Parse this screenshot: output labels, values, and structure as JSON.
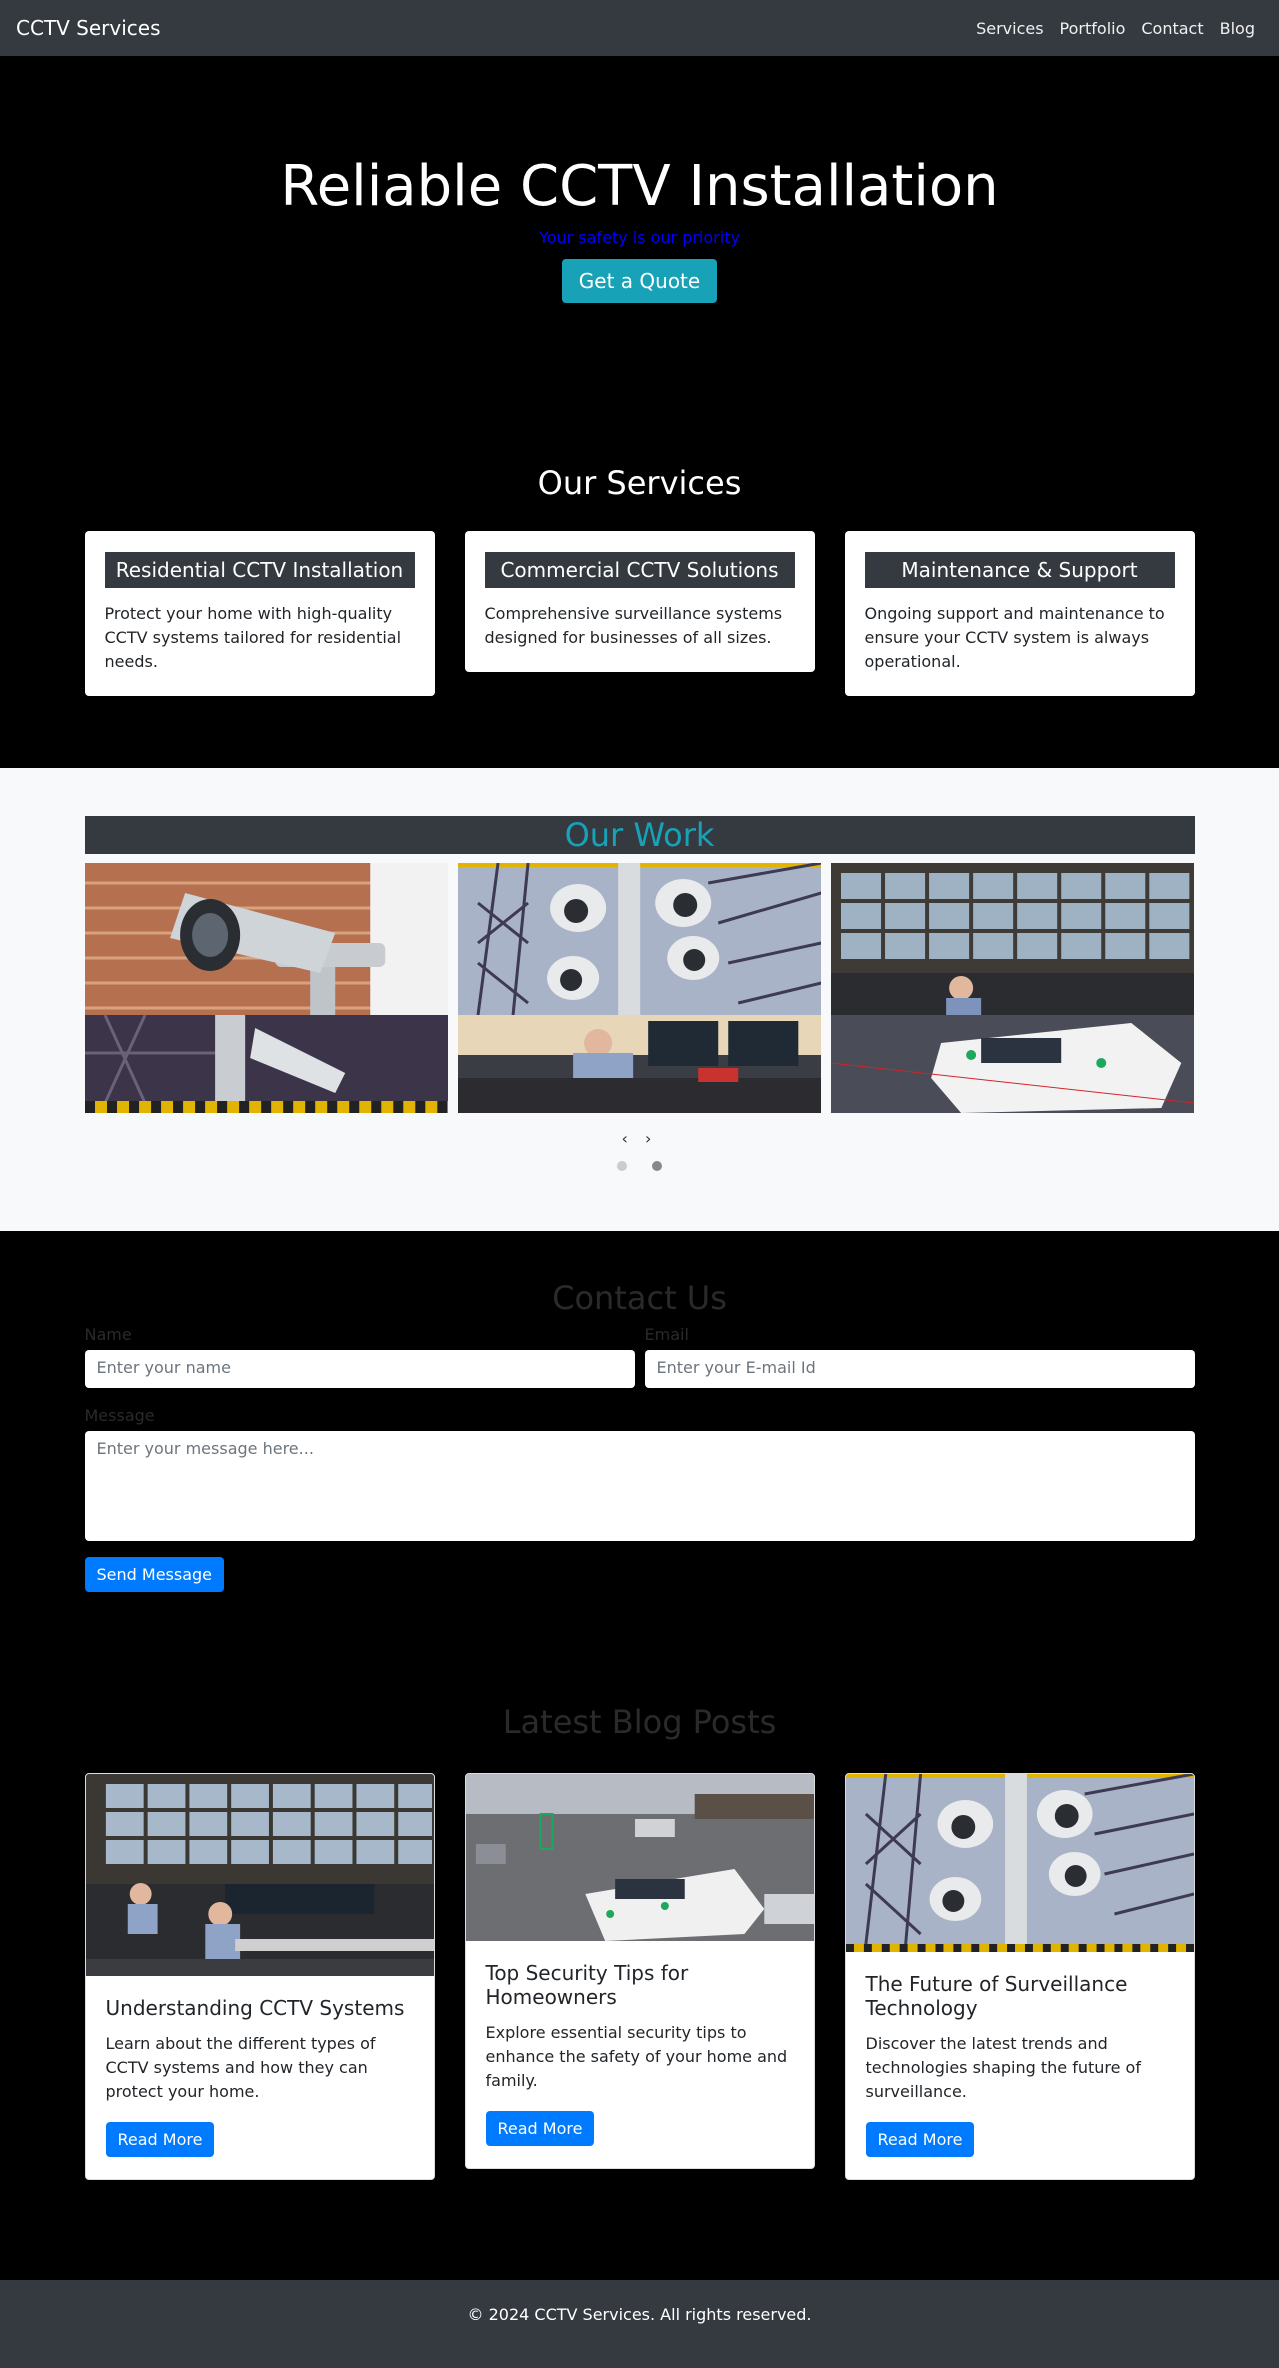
{
  "nav": {
    "brand": "CCTV Services",
    "links": [
      "Services",
      "Portfolio",
      "Contact",
      "Blog"
    ]
  },
  "hero": {
    "title": "Reliable CCTV Installation",
    "tagline": "Your safety is our priority",
    "cta": "Get a Quote"
  },
  "services": {
    "title": "Our Services",
    "items": [
      {
        "title": "Residential CCTV Installation",
        "text": "Protect your home with high-quality CCTV systems tailored for residential needs."
      },
      {
        "title": "Commercial CCTV Solutions",
        "text": "Comprehensive surveillance systems designed for businesses of all sizes."
      },
      {
        "title": "Maintenance & Support",
        "text": "Ongoing support and maintenance to ensure your CCTV system is always operational."
      }
    ]
  },
  "work": {
    "title": "Our Work",
    "prev": "‹",
    "next": "›",
    "slides": 2,
    "active_slide": 2
  },
  "contact": {
    "title": "Contact Us",
    "name_label": "Name",
    "name_placeholder": "Enter your name",
    "email_label": "Email",
    "email_placeholder": "Enter your E-mail Id",
    "message_label": "Message",
    "message_placeholder": "Enter your message here...",
    "submit": "Send Message"
  },
  "blog": {
    "title": "Latest Blog Posts",
    "posts": [
      {
        "title": "Understanding CCTV Systems",
        "text": "Learn about the different types of CCTV systems and how they can protect your home.",
        "cta": "Read More"
      },
      {
        "title": "Top Security Tips for Homeowners",
        "text": "Explore essential security tips to enhance the safety of your home and family.",
        "cta": "Read More"
      },
      {
        "title": "The Future of Surveillance Technology",
        "text": "Discover the latest trends and technologies shaping the future of surveillance.",
        "cta": "Read More"
      }
    ]
  },
  "footer": {
    "text": "© 2024 CCTV Services. All rights reserved."
  }
}
